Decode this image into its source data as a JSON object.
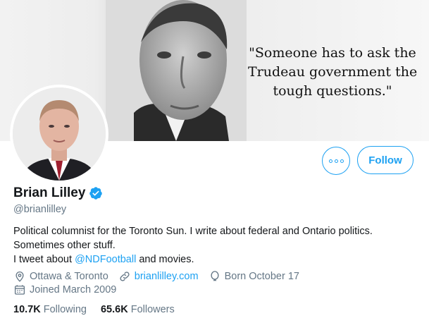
{
  "banner": {
    "quote_lines": [
      "\"Someone has to ask the",
      "Trudeau government the",
      "tough questions.\""
    ]
  },
  "actions": {
    "more_icon": "more-horizontal-icon",
    "follow_label": "Follow"
  },
  "profile": {
    "name": "Brian Lilley",
    "verified_icon": "verified-badge-icon",
    "handle": "@brianlilley",
    "bio_line1": "Political columnist for the Toronto Sun. I write about federal and Ontario politics.",
    "bio_line2": "Sometimes other stuff.",
    "bio_line3_prefix": "I tweet about ",
    "bio_line3_mention": "@NDFootball",
    "bio_line3_suffix": " and movies.",
    "location": "Ottawa & Toronto",
    "website": "brianlilley.com",
    "birthday": "Born October 17",
    "joined": "Joined March 2009"
  },
  "stats": {
    "following_count": "10.7K",
    "following_label": "Following",
    "followers_count": "65.6K",
    "followers_label": "Followers"
  },
  "colors": {
    "accent": "#1da1f2",
    "secondary_text": "#657786",
    "primary_text": "#14171a"
  }
}
